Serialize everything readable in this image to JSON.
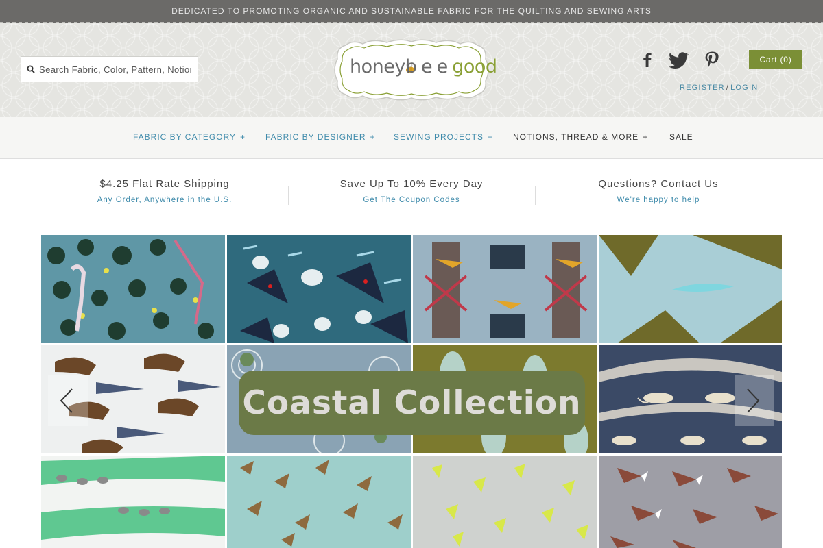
{
  "topbar": {
    "text": "DEDICATED TO PROMOTING ORGANIC AND SUSTAINABLE FABRIC FOR THE QUILTING AND SEWING ARTS"
  },
  "search": {
    "placeholder": "Search Fabric, Color, Pattern, Notions",
    "icon": "search-icon"
  },
  "logo": {
    "part1": "honey",
    "part2": "bee",
    "part3": "good"
  },
  "social": {
    "facebook": "facebook-icon",
    "twitter": "twitter-icon",
    "pinterest": "pinterest-icon"
  },
  "cart": {
    "label": "Cart (0)"
  },
  "account": {
    "register": "REGISTER",
    "separator": "/",
    "login": "LOGIN"
  },
  "nav": {
    "items": [
      {
        "label": "FABRIC BY CATEGORY",
        "plus": "+"
      },
      {
        "label": "FABRIC BY DESIGNER",
        "plus": "+"
      },
      {
        "label": "SEWING PROJECTS",
        "plus": "+"
      },
      {
        "label": "NOTIONS, THREAD & MORE",
        "plus": "+"
      },
      {
        "label": "SALE"
      }
    ]
  },
  "promos": [
    {
      "title": "$4.25 Flat Rate Shipping",
      "subtitle": "Any Order, Anywhere in the U.S."
    },
    {
      "title": "Save Up To 10% Every Day",
      "subtitle": "Get The Coupon Codes"
    },
    {
      "title": "Questions? Contact Us",
      "subtitle": "We're happy to help"
    }
  ],
  "slider": {
    "overlay_text": "Coastal Collection",
    "prev_icon": "chevron-left-icon",
    "next_icon": "chevron-right-icon"
  },
  "colors": {
    "topbar": "#6b6a68",
    "cart": "#7b8f36",
    "link": "#3f8bab",
    "logo_green": "#8aa035",
    "overlay": "#6b7a47"
  }
}
